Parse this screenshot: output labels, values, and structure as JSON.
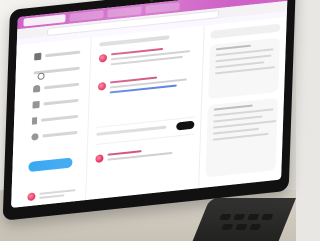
{
  "scene": {
    "description": "",
    "colors": {
      "browser_accent": "#cf62c7",
      "brand_blue": "#1d9bf0",
      "accent_red": "#e61e50"
    },
    "icons": [
      "home-icon",
      "search-icon",
      "bell-icon",
      "mail-icon",
      "bookmark-icon",
      "user-icon"
    ]
  }
}
